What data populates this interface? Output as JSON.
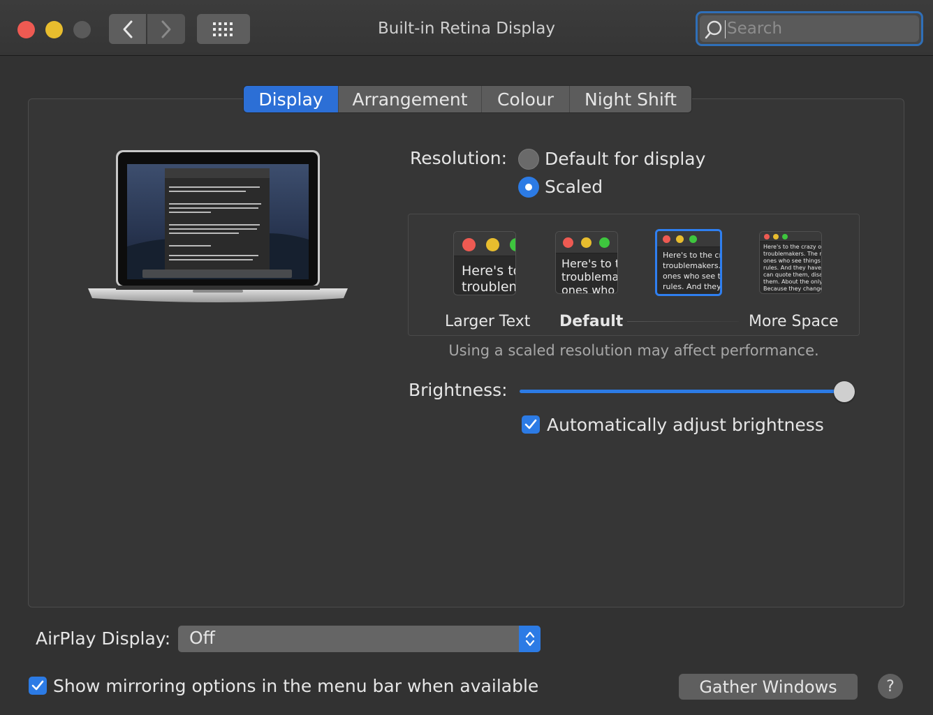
{
  "window": {
    "title": "Built-in Retina Display"
  },
  "search": {
    "placeholder": "Search"
  },
  "tabs": [
    {
      "label": "Display",
      "active": true
    },
    {
      "label": "Arrangement",
      "active": false
    },
    {
      "label": "Colour",
      "active": false
    },
    {
      "label": "Night Shift",
      "active": false
    }
  ],
  "resolution": {
    "label": "Resolution:",
    "options": [
      {
        "label": "Default for display",
        "selected": false
      },
      {
        "label": "Scaled",
        "selected": true
      }
    ]
  },
  "scaled_options": {
    "thumbs": [
      {
        "text": "Here's to\ntroublem",
        "selected": false
      },
      {
        "text": "Here's to t\ntroublema\nones who",
        "selected": false
      },
      {
        "text": "Here's to the cr\ntroublemakers.\nones who see t\nrules. And they",
        "selected": true
      },
      {
        "text": "Here's to the crazy one\ntroublemakers. The rou\nones who see things dif\nrules. And they have no\ncan quote them, disagr\nthem. About the only th\nBecause they change th",
        "selected": false
      }
    ],
    "labels": {
      "larger": "Larger Text",
      "default": "Default",
      "more": "More Space"
    },
    "note": "Using a scaled resolution may affect performance."
  },
  "brightness": {
    "label": "Brightness:",
    "value": 1.0
  },
  "auto_brightness": {
    "label": "Automatically adjust brightness",
    "checked": true
  },
  "airplay": {
    "label": "AirPlay Display:",
    "value": "Off"
  },
  "mirroring": {
    "label": "Show mirroring options in the menu bar when available",
    "checked": true
  },
  "buttons": {
    "gather": "Gather Windows",
    "help": "?"
  },
  "colors": {
    "accent": "#2c7be5",
    "background": "#323232"
  }
}
